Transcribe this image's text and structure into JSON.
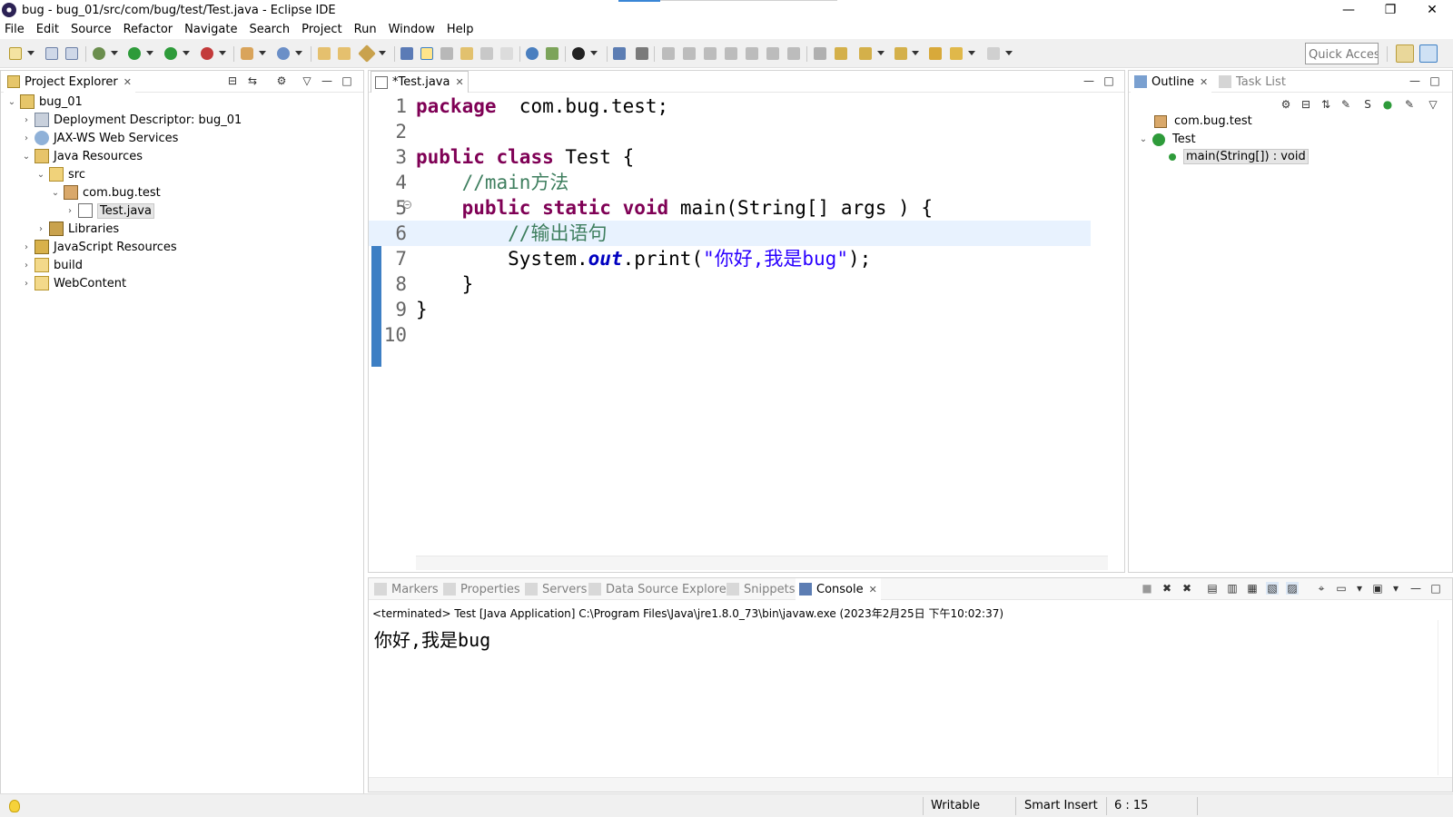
{
  "window": {
    "title": "bug - bug_01/src/com/bug/test/Test.java - Eclipse IDE",
    "controls": [
      "—",
      "❐",
      "✕"
    ]
  },
  "menu": [
    "File",
    "Edit",
    "Source",
    "Refactor",
    "Navigate",
    "Search",
    "Project",
    "Run",
    "Window",
    "Help"
  ],
  "toolbar": {
    "quick_access_placeholder": "Quick Access"
  },
  "project_explorer": {
    "tab_label": "Project Explorer",
    "tree": [
      {
        "label": "bug_01",
        "chev": "⌄",
        "icon": "project-icon"
      },
      {
        "label": "Deployment Descriptor: bug_01",
        "chev": "›",
        "icon": "deployment-descriptor-icon"
      },
      {
        "label": "JAX-WS Web Services",
        "chev": "›",
        "icon": "web-services-icon"
      },
      {
        "label": "Java Resources",
        "chev": "⌄",
        "icon": "java-resources-icon"
      },
      {
        "label": "src",
        "chev": "⌄",
        "icon": "source-folder-icon"
      },
      {
        "label": "com.bug.test",
        "chev": "⌄",
        "icon": "package-icon"
      },
      {
        "label": "Test.java",
        "chev": "›",
        "icon": "java-file-icon"
      },
      {
        "label": "Libraries",
        "chev": "›",
        "icon": "libraries-icon"
      },
      {
        "label": "JavaScript Resources",
        "chev": "›",
        "icon": "javascript-resources-icon"
      },
      {
        "label": "build",
        "chev": "›",
        "icon": "folder-icon"
      },
      {
        "label": "WebContent",
        "chev": "›",
        "icon": "folder-icon"
      }
    ]
  },
  "editor": {
    "tab_label": "*Test.java",
    "current_line": 6,
    "lines": [
      {
        "num": "1",
        "parts": [
          [
            "kw",
            "package"
          ],
          [
            "",
            "  com.bug.test;"
          ]
        ]
      },
      {
        "num": "2",
        "parts": []
      },
      {
        "num": "3",
        "parts": [
          [
            "kw",
            "public"
          ],
          [
            "",
            " "
          ],
          [
            "kw",
            "class"
          ],
          [
            "",
            " Test {"
          ]
        ]
      },
      {
        "num": "4",
        "parts": [
          [
            "",
            "    "
          ],
          [
            "cm",
            "//main方法"
          ]
        ]
      },
      {
        "num": "5",
        "parts": [
          [
            "",
            "    "
          ],
          [
            "kw",
            "public"
          ],
          [
            "",
            " "
          ],
          [
            "kw",
            "static"
          ],
          [
            "",
            " "
          ],
          [
            "kw",
            "void"
          ],
          [
            "",
            " main(String[] args ) {"
          ]
        ]
      },
      {
        "num": "6",
        "parts": [
          [
            "",
            "        "
          ],
          [
            "cm",
            "//输出语句"
          ]
        ]
      },
      {
        "num": "7",
        "parts": [
          [
            "",
            "        System."
          ],
          [
            "fld",
            "out"
          ],
          [
            "",
            ".print("
          ],
          [
            "st",
            "\"你好,我是bug\""
          ],
          [
            "",
            ");"
          ]
        ]
      },
      {
        "num": "8",
        "parts": [
          [
            "",
            "    }"
          ]
        ]
      },
      {
        "num": "9",
        "parts": [
          [
            "",
            "}"
          ]
        ]
      },
      {
        "num": "10",
        "parts": []
      }
    ]
  },
  "outline": {
    "tab_label": "Outline",
    "task_list_label": "Task List",
    "items": [
      {
        "label": "com.bug.test",
        "chev": "",
        "icon": "package-icon"
      },
      {
        "label": "Test",
        "chev": "⌄",
        "icon": "class-icon"
      },
      {
        "label": "main(String[]) : void",
        "chev": "",
        "icon": "public-method-icon"
      }
    ]
  },
  "bottom_tabs": [
    {
      "label": "Markers",
      "icon": "markers-icon"
    },
    {
      "label": "Properties",
      "icon": "properties-icon"
    },
    {
      "label": "Servers",
      "icon": "servers-icon"
    },
    {
      "label": "Data Source Explorer",
      "icon": "data-source-icon"
    },
    {
      "label": "Snippets",
      "icon": "snippets-icon"
    },
    {
      "label": "Console",
      "icon": "console-icon"
    }
  ],
  "console": {
    "header": "<terminated> Test [Java Application] C:\\Program Files\\Java\\jre1.8.0_73\\bin\\javaw.exe (2023年2月25日 下午10:02:37)",
    "output": "你好,我是bug"
  },
  "status": {
    "writable": "Writable",
    "insert_mode": "Smart Insert",
    "position": "6 : 15"
  },
  "colors": {
    "keyword": "#7f0055",
    "comment": "#3f7f5f",
    "string": "#2a00ff",
    "field": "#0000c0",
    "current_line": "#e8f2fe",
    "accent": "#3d7fc4"
  }
}
